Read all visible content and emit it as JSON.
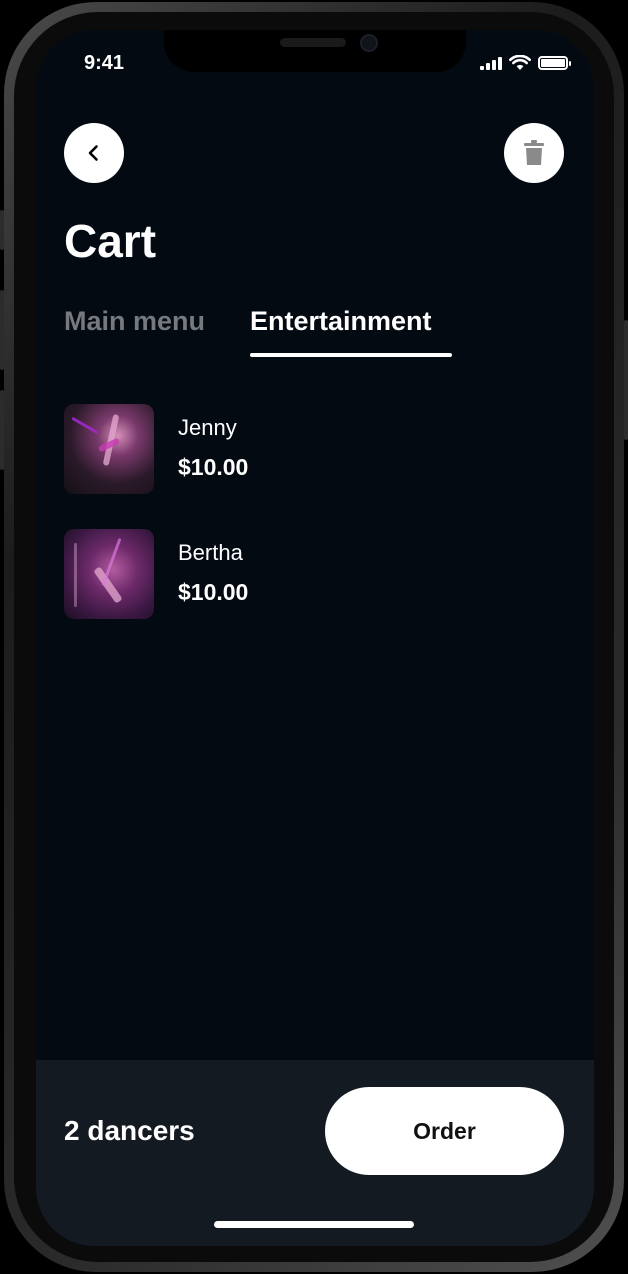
{
  "status_bar": {
    "time": "9:41"
  },
  "header": {
    "back_icon": "chevron-left-icon",
    "trash_icon": "trash-icon",
    "title": "Cart"
  },
  "tabs": [
    {
      "label": "Main menu",
      "active": false
    },
    {
      "label": "Entertainment",
      "active": true
    }
  ],
  "cart_items": [
    {
      "name": "Jenny",
      "price": "$10.00"
    },
    {
      "name": "Bertha",
      "price": "$10.00"
    }
  ],
  "footer": {
    "count_label": "2 dancers",
    "order_label": "Order"
  },
  "colors": {
    "background": "#030a12",
    "bottom_bar": "#141a21",
    "inactive_tab": "#76797e",
    "accent": "#ffffff"
  }
}
